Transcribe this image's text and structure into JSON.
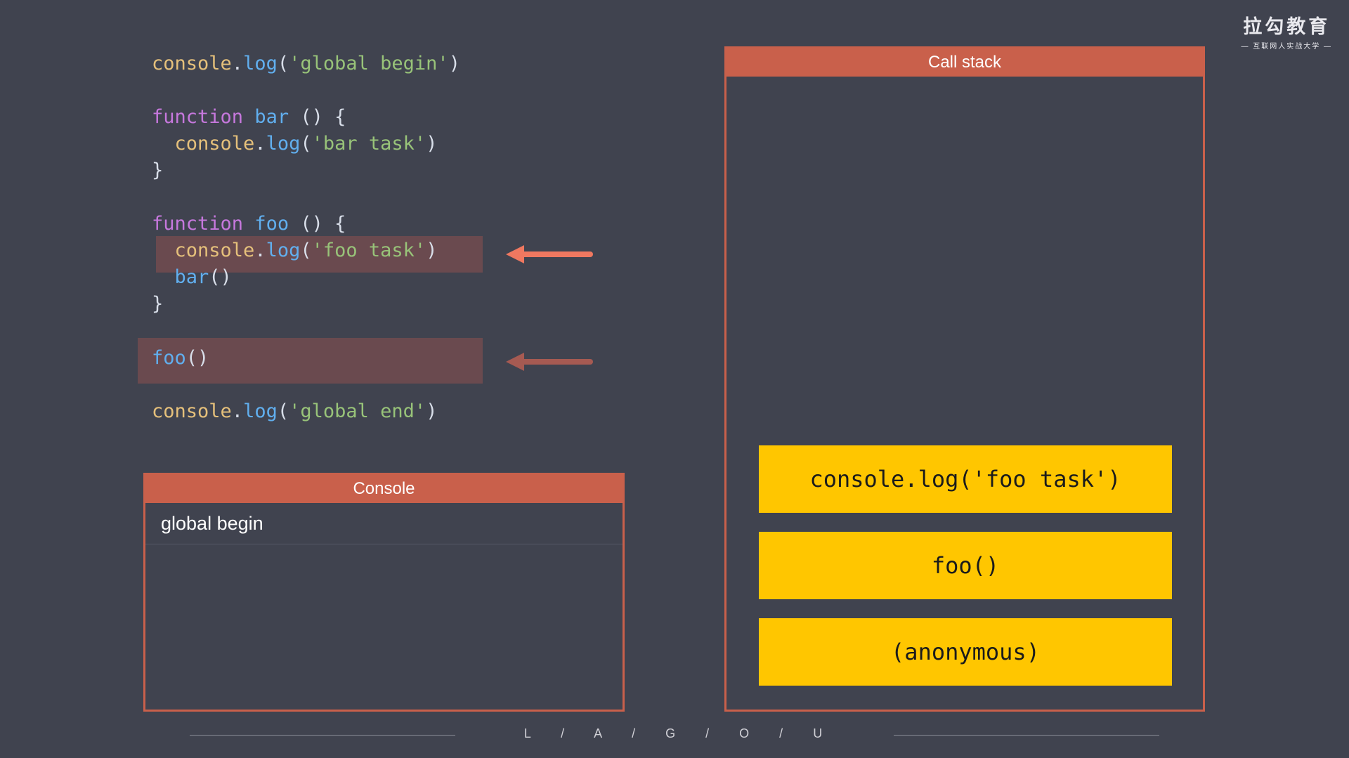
{
  "code": {
    "lines": [
      [
        [
          "obj",
          "console"
        ],
        [
          "p",
          "."
        ],
        [
          "fn",
          "log"
        ],
        [
          "p",
          "("
        ],
        [
          "str",
          "'global begin'"
        ],
        [
          "p",
          ")"
        ]
      ],
      [],
      [
        [
          "kw",
          "function"
        ],
        [
          "p",
          " "
        ],
        [
          "fn",
          "bar"
        ],
        [
          "p",
          " () {"
        ]
      ],
      [
        [
          "p",
          "  "
        ],
        [
          "obj",
          "console"
        ],
        [
          "p",
          "."
        ],
        [
          "fn",
          "log"
        ],
        [
          "p",
          "("
        ],
        [
          "str",
          "'bar task'"
        ],
        [
          "p",
          ")"
        ]
      ],
      [
        [
          "p",
          "}"
        ]
      ],
      [],
      [
        [
          "kw",
          "function"
        ],
        [
          "p",
          " "
        ],
        [
          "fn",
          "foo"
        ],
        [
          "p",
          " () {"
        ]
      ],
      [
        [
          "p",
          "  "
        ],
        [
          "obj",
          "console"
        ],
        [
          "p",
          "."
        ],
        [
          "fn",
          "log"
        ],
        [
          "p",
          "("
        ],
        [
          "str",
          "'foo task'"
        ],
        [
          "p",
          ")"
        ]
      ],
      [
        [
          "p",
          "  "
        ],
        [
          "fn",
          "bar"
        ],
        [
          "p",
          "()"
        ]
      ],
      [
        [
          "p",
          "}"
        ]
      ],
      [],
      [
        [
          "fn",
          "foo"
        ],
        [
          "p",
          "()"
        ]
      ],
      [],
      [
        [
          "obj",
          "console"
        ],
        [
          "p",
          "."
        ],
        [
          "fn",
          "log"
        ],
        [
          "p",
          "("
        ],
        [
          "str",
          "'global end'"
        ],
        [
          "p",
          ")"
        ]
      ]
    ],
    "highlighted_lines": [
      7,
      11
    ]
  },
  "console": {
    "title": "Console",
    "lines": [
      "global begin"
    ]
  },
  "call_stack": {
    "title": "Call stack",
    "frames": [
      "console.log('foo task')",
      "foo()",
      "(anonymous)"
    ]
  },
  "brand": {
    "name": "拉勾教育",
    "tagline": "— 互联网人实战大学 —"
  },
  "footer": {
    "text": "L / A / G / O / U"
  },
  "colors": {
    "background": "#40434f",
    "accent": "#c9604b",
    "frame": "#ffc600",
    "arrow_active": "#f07860",
    "arrow_inactive": "#a65a52",
    "highlight": "#6a4a4f"
  }
}
